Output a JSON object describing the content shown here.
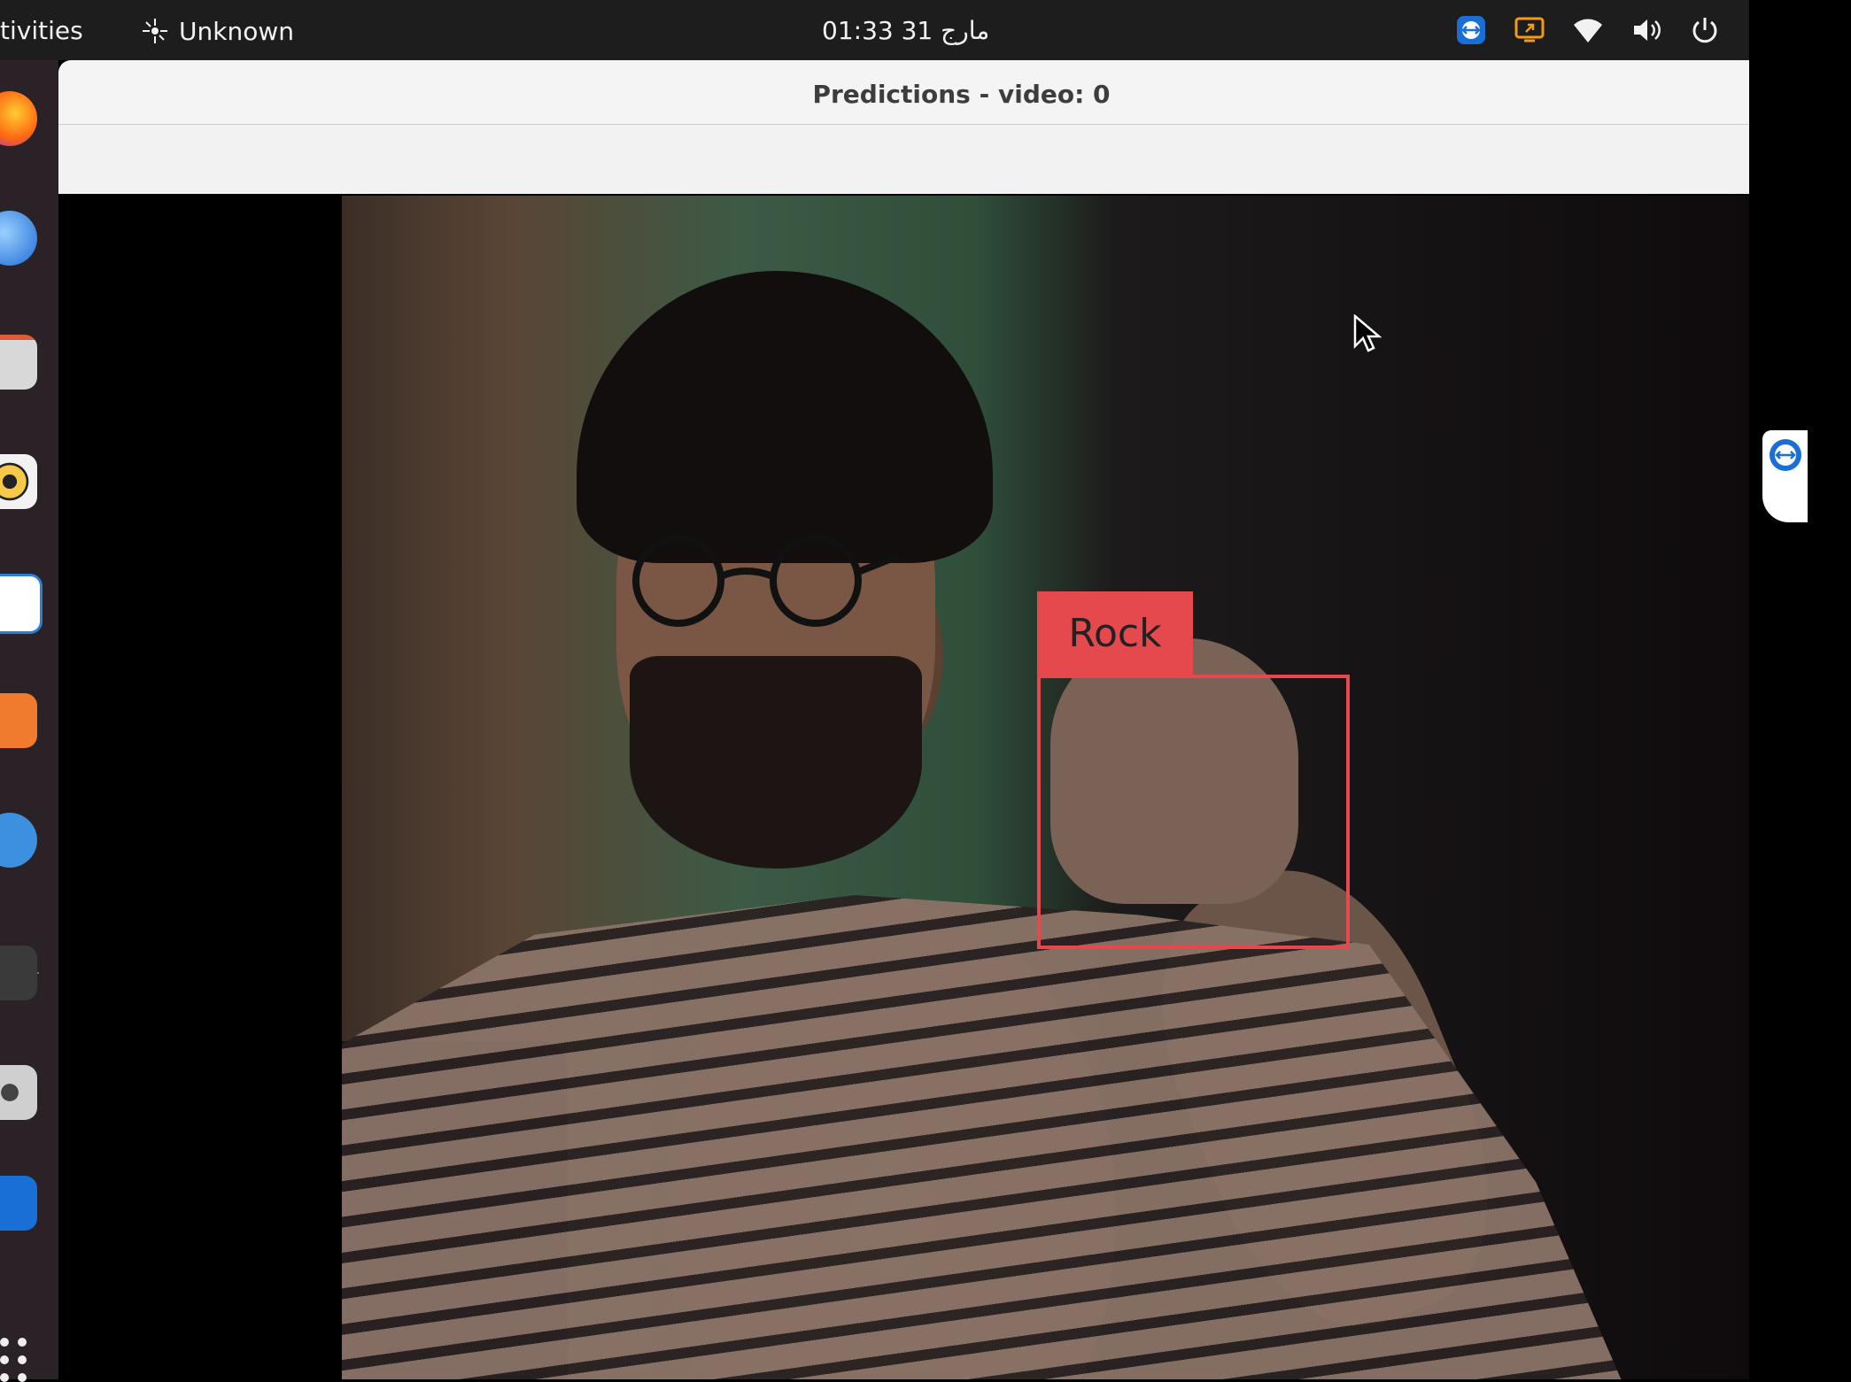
{
  "topbar": {
    "activities_label": "tivities",
    "app_indicator_label": "Unknown",
    "clock": "01:33  31 مارج",
    "tray_icons": [
      "teamviewer-icon",
      "screen-share-icon",
      "wifi-icon",
      "volume-icon",
      "power-icon"
    ]
  },
  "dock": {
    "items": [
      "firefox-icon",
      "thunderbird-icon",
      "files-icon",
      "rhythmbox-icon",
      "writer-icon",
      "software-center-icon",
      "help-icon",
      "blank-app-icon",
      "settings-icon",
      "teamviewer-icon"
    ],
    "show_apps_icon": "apps-grid-icon"
  },
  "window": {
    "title": "Predictions - video: 0"
  },
  "detection": {
    "label": "Rock",
    "color": "#e5484d"
  },
  "colors": {
    "topbar_bg": "#1d1d1d",
    "dock_bg": "#2a2226",
    "window_title_bg": "#f4f4f4",
    "detection_red": "#e5484d"
  }
}
